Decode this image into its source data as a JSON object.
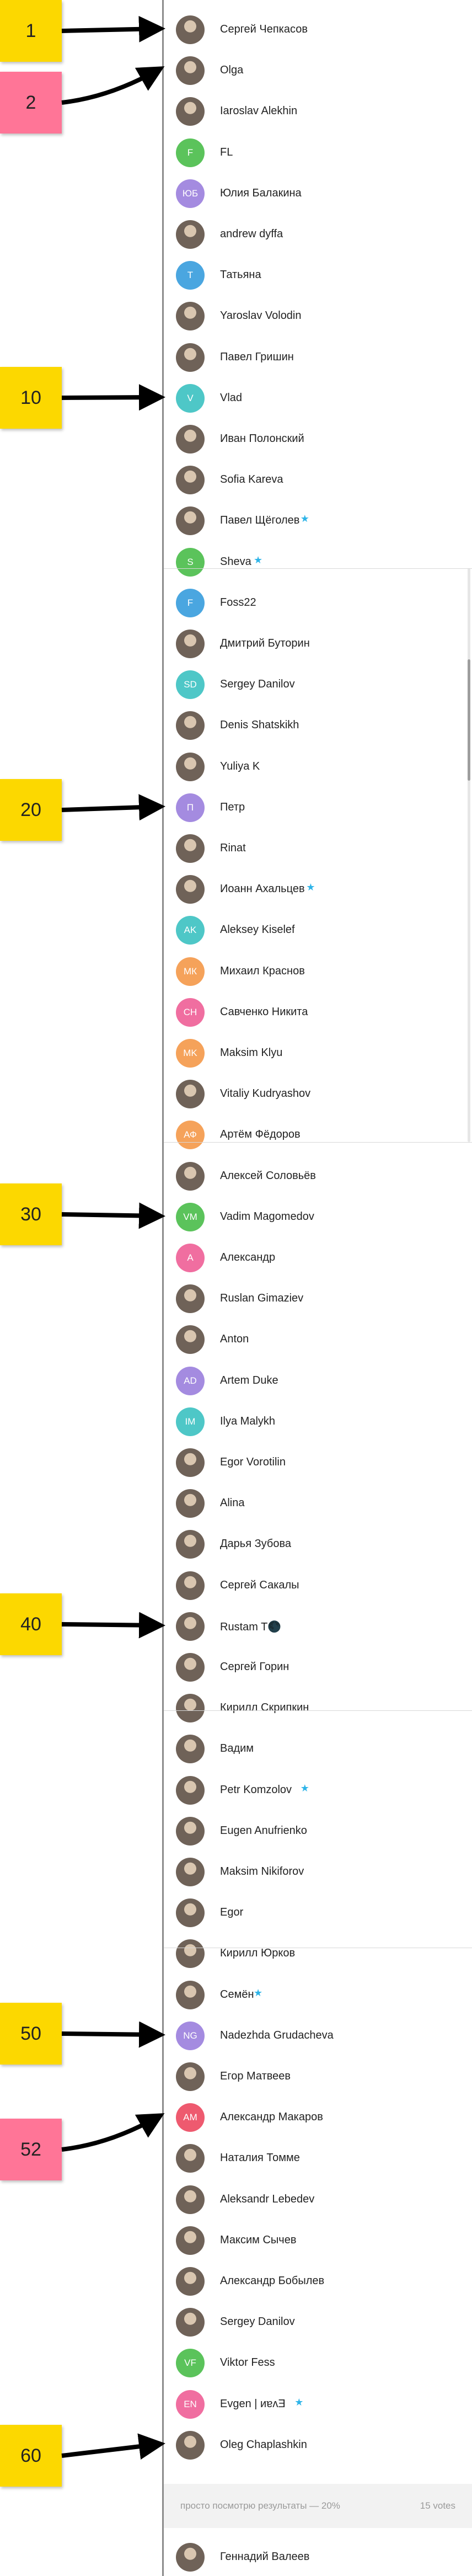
{
  "colors": {
    "sticky_yellow": "#fcd800",
    "sticky_pink": "#ff7597",
    "star": "#2eb4e8"
  },
  "stickies": [
    {
      "label": "1",
      "color": "yellow"
    },
    {
      "label": "2",
      "color": "pink"
    },
    {
      "label": "10",
      "color": "yellow"
    },
    {
      "label": "20",
      "color": "yellow"
    },
    {
      "label": "30",
      "color": "yellow"
    },
    {
      "label": "40",
      "color": "yellow"
    },
    {
      "label": "50",
      "color": "yellow"
    },
    {
      "label": "52",
      "color": "pink"
    },
    {
      "label": "60",
      "color": "yellow"
    }
  ],
  "voters": [
    {
      "name": "Сергей Чепкасов",
      "initials": "",
      "color": "",
      "star": false
    },
    {
      "name": "Olga",
      "initials": "",
      "color": "",
      "star": false
    },
    {
      "name": "Iaroslav Alekhin",
      "initials": "",
      "color": "",
      "star": false
    },
    {
      "name": "FL",
      "initials": "F",
      "color": "#5bc35b",
      "star": false
    },
    {
      "name": "Юлия Балакина",
      "initials": "ЮБ",
      "color": "#a48be0",
      "star": false
    },
    {
      "name": "andrew dyffa",
      "initials": "",
      "color": "",
      "star": false
    },
    {
      "name": "Татьяна",
      "initials": "Т",
      "color": "#4aa6e0",
      "star": false
    },
    {
      "name": "Yaroslav Volodin",
      "initials": "",
      "color": "",
      "star": false
    },
    {
      "name": "Павел Гришин",
      "initials": "",
      "color": "",
      "star": false
    },
    {
      "name": "Vlad",
      "initials": "V",
      "color": "#4ec7c7",
      "star": false
    },
    {
      "name": "Иван Полонский",
      "initials": "",
      "color": "",
      "star": false
    },
    {
      "name": "Sofia Kareva",
      "initials": "",
      "color": "",
      "star": false
    },
    {
      "name": "Павел Щёголев",
      "initials": "",
      "color": "",
      "star": true
    },
    {
      "name": "Sheva",
      "initials": "S",
      "color": "#5bc35b",
      "star": true
    },
    {
      "name": "Foss22",
      "initials": "F",
      "color": "#4aa6e0",
      "star": false
    },
    {
      "name": "Дмитрий Буторин",
      "initials": "",
      "color": "",
      "star": false
    },
    {
      "name": "Sergey Danilov",
      "initials": "SD",
      "color": "#4ec7c7",
      "star": false
    },
    {
      "name": "Denis Shatskikh",
      "initials": "",
      "color": "",
      "star": false
    },
    {
      "name": "Yuliya K",
      "initials": "",
      "color": "",
      "star": false
    },
    {
      "name": "Петр",
      "initials": "П",
      "color": "#a48be0",
      "star": false
    },
    {
      "name": "Rinat",
      "initials": "",
      "color": "",
      "star": false
    },
    {
      "name": "Иоанн Ахальцев",
      "initials": "",
      "color": "",
      "star": true
    },
    {
      "name": "Aleksey Kiselef",
      "initials": "AK",
      "color": "#4ec7c7",
      "star": false
    },
    {
      "name": "Михаил Краснов",
      "initials": "МК",
      "color": "#f5a25a",
      "star": false
    },
    {
      "name": "Савченко Никита",
      "initials": "СН",
      "color": "#f06ea0",
      "star": false
    },
    {
      "name": "Maksim Klyu",
      "initials": "MK",
      "color": "#f5a25a",
      "star": false
    },
    {
      "name": "Vitaliy Kudryashov",
      "initials": "",
      "color": "",
      "star": false
    },
    {
      "name": "Артём Фёдоров",
      "initials": "АФ",
      "color": "#f5a25a",
      "star": false
    },
    {
      "name": "Алексей Соловьёв",
      "initials": "",
      "color": "",
      "star": false
    },
    {
      "name": "Vadim Magomedov",
      "initials": "VM",
      "color": "#5bc35b",
      "star": false
    },
    {
      "name": "Александр",
      "initials": "А",
      "color": "#f06ea0",
      "star": false
    },
    {
      "name": "Ruslan Gimaziev",
      "initials": "",
      "color": "",
      "star": false
    },
    {
      "name": "Anton",
      "initials": "",
      "color": "",
      "star": false
    },
    {
      "name": "Artem Duke",
      "initials": "AD",
      "color": "#a48be0",
      "star": false
    },
    {
      "name": "Ilya Malykh",
      "initials": "IM",
      "color": "#4ec7c7",
      "star": false
    },
    {
      "name": "Egor Vorotilin",
      "initials": "",
      "color": "",
      "star": false
    },
    {
      "name": "Alina",
      "initials": "",
      "color": "",
      "star": false
    },
    {
      "name": "Дарья Зубова",
      "initials": "",
      "color": "",
      "star": false
    },
    {
      "name": "Сергей Сакалы",
      "initials": "",
      "color": "",
      "star": false
    },
    {
      "name": "Rustam T🌑",
      "initials": "",
      "color": "",
      "star": false
    },
    {
      "name": "Сергей Горин",
      "initials": "",
      "color": "",
      "star": false
    },
    {
      "name": "Кирилл Скрипкин",
      "initials": "",
      "color": "",
      "star": false
    },
    {
      "name": "Вадим",
      "initials": "",
      "color": "",
      "star": false
    },
    {
      "name": "Petr Komzolov",
      "initials": "",
      "color": "",
      "star": true
    },
    {
      "name": "Eugen Anufrienko",
      "initials": "",
      "color": "",
      "star": false
    },
    {
      "name": "Maksim Nikiforov",
      "initials": "",
      "color": "",
      "star": false
    },
    {
      "name": "Egor",
      "initials": "",
      "color": "",
      "star": false
    },
    {
      "name": "Кирилл Юрков",
      "initials": "",
      "color": "",
      "star": false
    },
    {
      "name": "Семён",
      "initials": "",
      "color": "",
      "star": true
    },
    {
      "name": "Nadezhda Grudacheva",
      "initials": "NG",
      "color": "#a48be0",
      "star": false
    },
    {
      "name": "Егор Матвеев",
      "initials": "",
      "color": "",
      "star": false
    },
    {
      "name": "Александр Макаров",
      "initials": "АМ",
      "color": "#ee5a6f",
      "star": false
    },
    {
      "name": "Наталия Томме",
      "initials": "",
      "color": "",
      "star": false
    },
    {
      "name": "Aleksandr Lebedev",
      "initials": "",
      "color": "",
      "star": false
    },
    {
      "name": "Максим Сычев",
      "initials": "",
      "color": "",
      "star": false
    },
    {
      "name": "Александр Бобылев",
      "initials": "",
      "color": "",
      "star": false
    },
    {
      "name": "Sergey Danilov",
      "initials": "",
      "color": "",
      "star": false
    },
    {
      "name": "Viktor Fess",
      "initials": "VF",
      "color": "#5bc35b",
      "star": false
    },
    {
      "name": "Evgen | ᴎɐʌƎ",
      "initials": "EN",
      "color": "#f06ea0",
      "star": true
    },
    {
      "name": "Oleg Chaplashkin",
      "initials": "",
      "color": "",
      "star": false
    },
    {
      "name": "Геннадий Валеев",
      "initials": "",
      "color": "",
      "star": false
    }
  ],
  "results": {
    "text": "просто посмотрю результаты — 20%",
    "votes": "15 votes"
  }
}
